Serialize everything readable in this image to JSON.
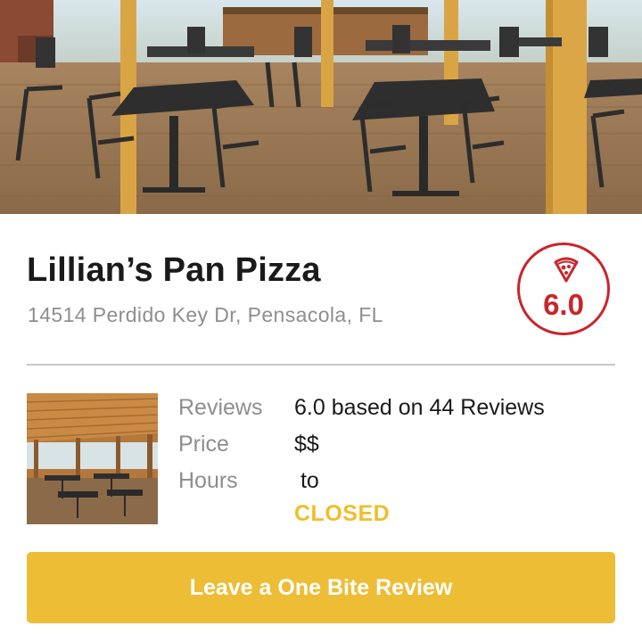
{
  "restaurant": {
    "name": "Lillian’s Pan Pizza",
    "address": "14514 Perdido Key Dr, Pensacola, FL"
  },
  "score_badge": {
    "icon": "pizza-slice-icon",
    "value": "6.0",
    "color": "#c8262c"
  },
  "info": {
    "reviews_label": "Reviews",
    "reviews_value": "6.0 based on 44 Reviews",
    "price_label": "Price",
    "price_value": "$$",
    "hours_label": "Hours",
    "hours_value": " to",
    "status": "CLOSED"
  },
  "cta": {
    "label": "Leave a One Bite Review",
    "color": "#edbd35"
  },
  "colors": {
    "accent_red": "#c8262c",
    "accent_yellow": "#edbd35",
    "status_yellow": "#f0be2a",
    "muted_text": "#8e8e8e"
  }
}
